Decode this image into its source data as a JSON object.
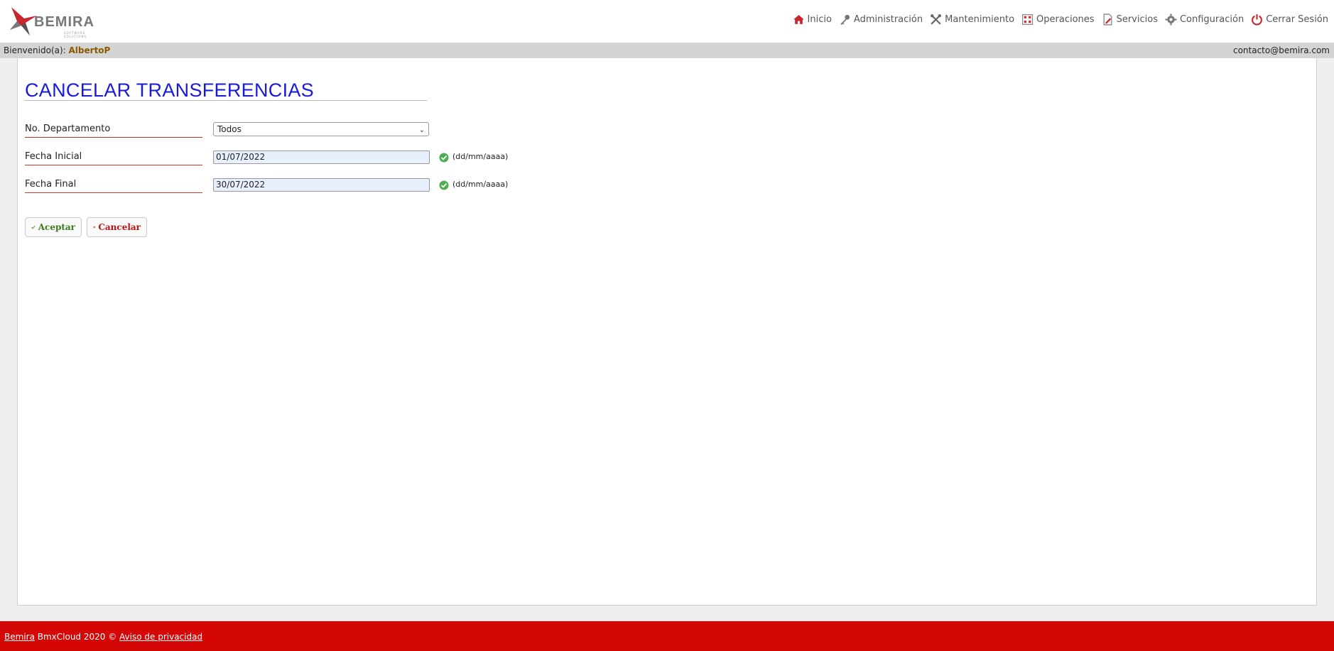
{
  "brand": {
    "name": "BEMIRA",
    "tagline": "SOFTWARE SOLUTIONS"
  },
  "nav": [
    {
      "label": "Inicio",
      "icon": "home-icon"
    },
    {
      "label": "Administración",
      "icon": "key-icon"
    },
    {
      "label": "Mantenimiento",
      "icon": "tools-icon"
    },
    {
      "label": "Operaciones",
      "icon": "calculator-icon"
    },
    {
      "label": "Servicios",
      "icon": "document-edit-icon"
    },
    {
      "label": "Configuración",
      "icon": "gear-icon"
    },
    {
      "label": "Cerrar Sesión",
      "icon": "power-icon"
    }
  ],
  "welcome": {
    "prefix": "Bienvenido(a): ",
    "user": "AlbertoP",
    "email": "contacto@bemira.com"
  },
  "page": {
    "title": "CANCELAR TRANSFERENCIAS"
  },
  "form": {
    "department": {
      "label": "No. Departamento",
      "value": "Todos"
    },
    "start_date": {
      "label": "Fecha Inicial",
      "value": "01/07/2022",
      "hint": "(dd/mm/aaaa)"
    },
    "end_date": {
      "label": "Fecha Final",
      "value": "30/07/2022",
      "hint": "(dd/mm/aaaa)"
    }
  },
  "buttons": {
    "accept": "Aceptar",
    "cancel": "Cancelar"
  },
  "footer": {
    "brand_link": "Bemira",
    "text": " BmxCloud 2020 © ",
    "privacy_link": "Aviso de privacidad"
  },
  "colors": {
    "title": "#1a1adb",
    "footer": "#d40606",
    "label_underline": "#cc3333",
    "accept": "#3a7d1a",
    "cancel": "#c01010"
  }
}
